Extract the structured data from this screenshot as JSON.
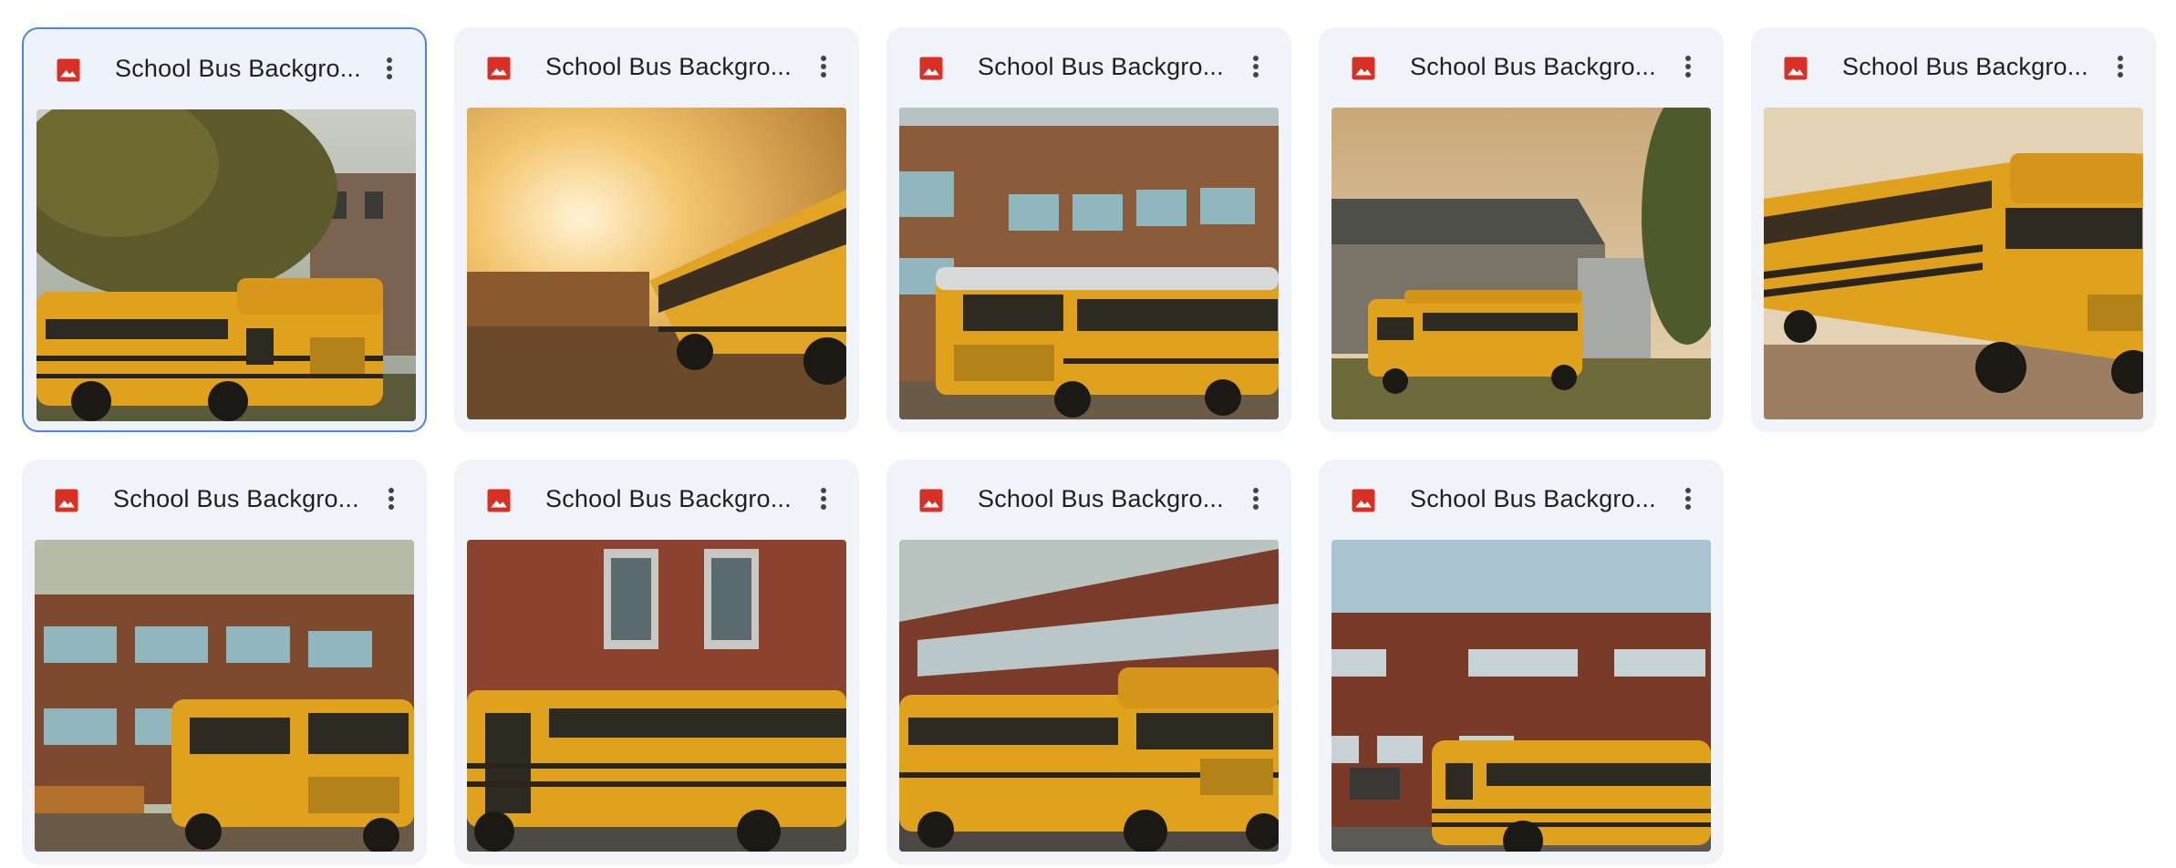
{
  "files": [
    {
      "name": "School Bus Backgro...",
      "type_icon": "image-icon",
      "selected": true
    },
    {
      "name": "School Bus Backgro...",
      "type_icon": "image-icon",
      "selected": false
    },
    {
      "name": "School Bus Backgro...",
      "type_icon": "image-icon",
      "selected": false
    },
    {
      "name": "School Bus Backgro...",
      "type_icon": "image-icon",
      "selected": false
    },
    {
      "name": "School Bus Backgro...",
      "type_icon": "image-icon",
      "selected": false
    },
    {
      "name": "School Bus Backgro...",
      "type_icon": "image-icon",
      "selected": false
    },
    {
      "name": "School Bus Backgro...",
      "type_icon": "image-icon",
      "selected": false
    },
    {
      "name": "School Bus Backgro...",
      "type_icon": "image-icon",
      "selected": false
    },
    {
      "name": "School Bus Backgro...",
      "type_icon": "image-icon",
      "selected": false
    }
  ],
  "colors": {
    "card_bg": "#f0f4f9",
    "selected_border": "#4a86e0",
    "image_icon": "#d93025",
    "bus_yellow": "#e0a21c"
  }
}
